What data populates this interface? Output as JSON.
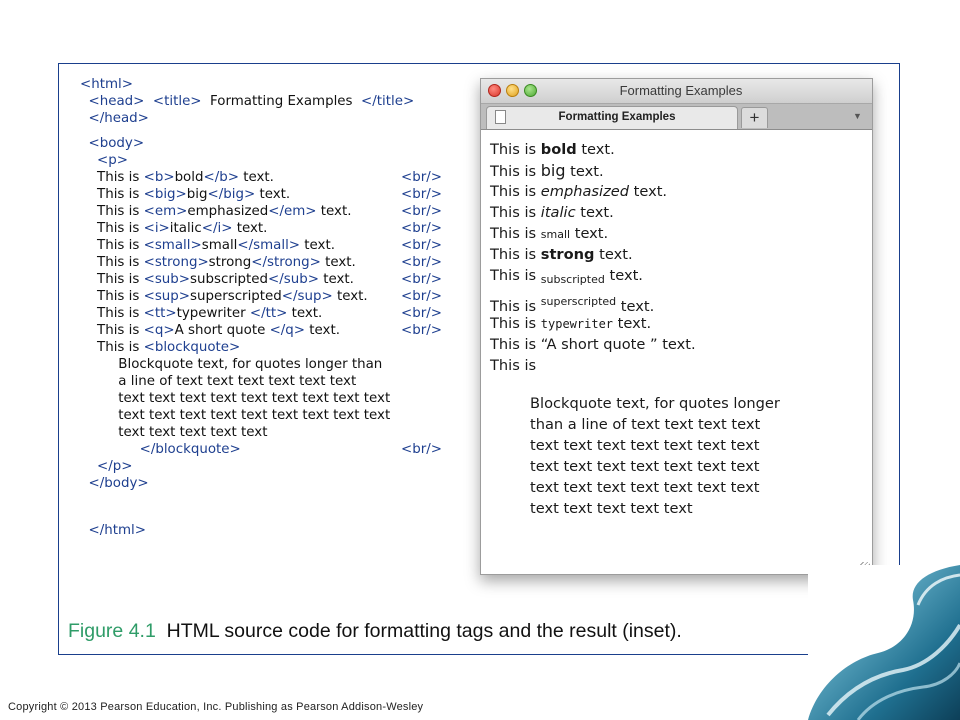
{
  "code": {
    "lines": [
      "<html>",
      "  <head>  <title>  Formatting Examples  </title>",
      "  </head>",
      "",
      "  <body>",
      "    <p>",
      "    This is <b>bold</b> text.",
      "    This is <big>big</big> text.",
      "    This is <em>emphasized</em> text.",
      "    This is <i>italic</i> text.",
      "    This is <small>small</small> text.",
      "    This is <strong>strong</strong> text.",
      "    This is <sub>subscripted</sub> text.",
      "    This is <sup>superscripted</sup> text.",
      "    This is <tt>typewriter </tt> text.",
      "    This is <q>A short quote </q> text.",
      "    This is <blockquote>",
      "         Blockquote text, for quotes longer than",
      "         a line of text text text text text text",
      "         text text text text text text text text text",
      "         text text text text text text text text text",
      "         text text text text text",
      "              </blockquote>",
      "    </p>",
      "  </body>",
      "",
      "  </html>"
    ],
    "br_tag": "<br/>"
  },
  "browser": {
    "window_title": "Formatting Examples",
    "tab_title": "Formatting Examples",
    "new_tab_symbol": "+",
    "prefix": "This is",
    "suffix": "text.",
    "words": {
      "bold": "bold",
      "big": "big",
      "emphasized": "emphasized",
      "italic": "italic",
      "small": "small",
      "strong": "strong",
      "subscripted": "subscripted",
      "superscripted": "superscripted",
      "typewriter": "typewriter",
      "quote": "“A short quote ”"
    },
    "blockquote_lines": [
      "Blockquote text, for quotes longer",
      "than a line of text text text text",
      "text text text text text text text",
      "text text text text text text text",
      "text text text text text text text",
      "text text text text text"
    ]
  },
  "caption": {
    "figure_number": "Figure 4.1",
    "text": "HTML source code for formatting tags and the result (inset)."
  },
  "copyright": "Copyright © 2013 Pearson Education, Inc. Publishing as Pearson Addison-Wesley"
}
